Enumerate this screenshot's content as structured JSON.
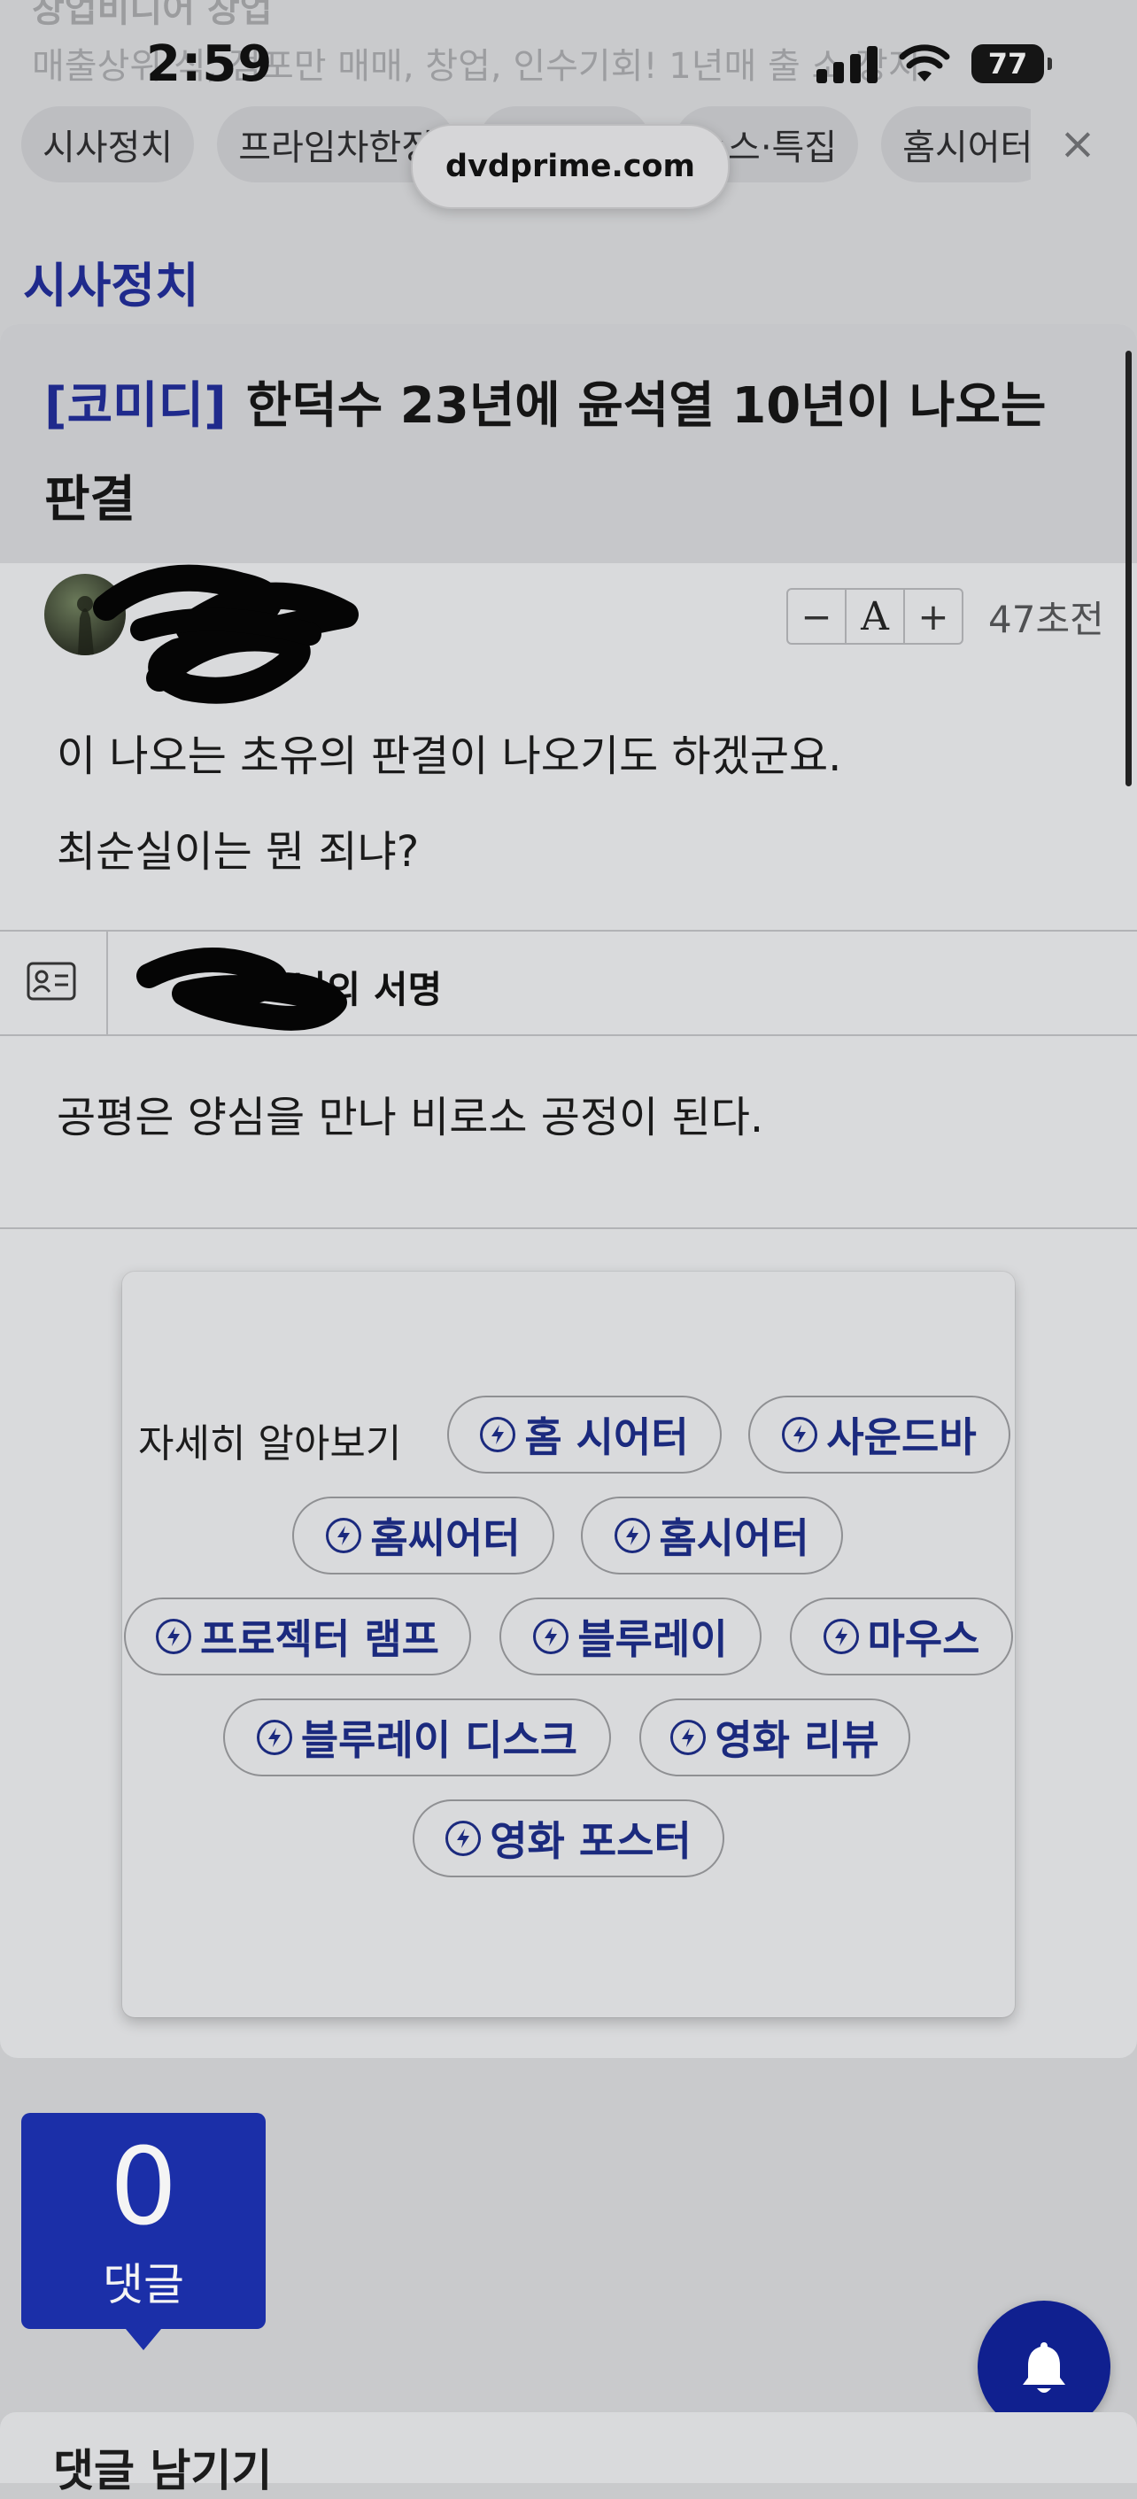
{
  "ad": {
    "title": "창업비디어 창업",
    "line": "매출상위 식, 점포만 매매, 창업, 인수기회! 1년매 출 소 장지"
  },
  "status_bar": {
    "time": "2:59",
    "battery": "77"
  },
  "url": "dvdprime.com",
  "categories": [
    "시사정치",
    "프라임차한정",
    "포토게디",
    "뉴스·특집",
    "홈시어터"
  ],
  "close_icon": "×",
  "section_title": "시사정치",
  "post": {
    "tag": "[코미디]",
    "title": "한덕수 23년에 윤석열 10년이 나오는 판결",
    "time_ago": "47초전",
    "font_controls": [
      "−",
      "A",
      "+"
    ],
    "body": [
      "이 나오는 초유의 판결이 나오기도 하겠군요.",
      "최순실이는 뭔 죄냐?"
    ],
    "signature_label": "님의 서명",
    "signature_text": "공평은 양심을 만나 비로소 공정이 된다."
  },
  "learn_more": {
    "label": "자세히 알아보기",
    "keywords": [
      "홈 시어터",
      "사운드바",
      "홈씨어터",
      "홈시어터",
      "프로젝터 램프",
      "블루레이",
      "마우스",
      "블루레이 디스크",
      "영화 리뷰",
      "영화 포스터"
    ]
  },
  "comments": {
    "count": "0",
    "label": "댓글"
  },
  "bottom": {
    "text": "댓글 남기기"
  },
  "colors": {
    "accent": "#1f2a8c",
    "badge": "#1b2fa8",
    "bell": "#10208f"
  },
  "icons": [
    "bolt-icon",
    "bell-icon",
    "profile-card-icon",
    "wifi-icon",
    "signal-icon",
    "battery-icon",
    "close-icon"
  ]
}
